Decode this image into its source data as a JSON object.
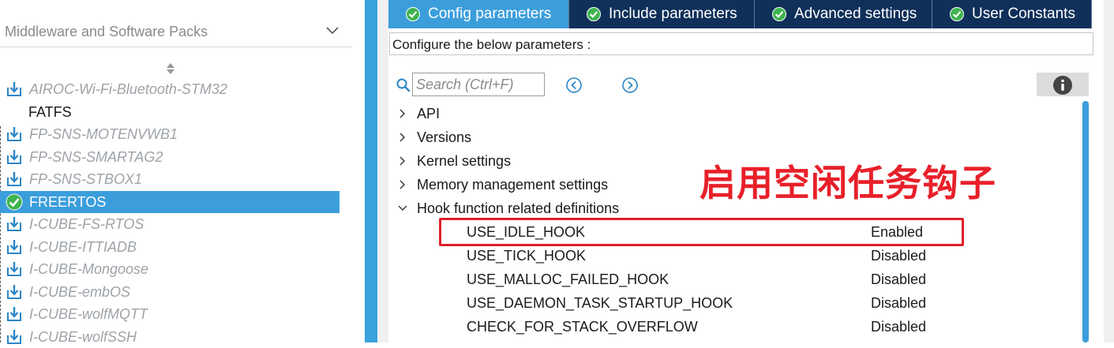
{
  "middleware": {
    "header": "Middleware and Software Packs",
    "packs": [
      {
        "label": "AIROC-Wi-Fi-Bluetooth-STM32",
        "kind": "download"
      },
      {
        "label": "FATFS",
        "kind": "plain"
      },
      {
        "label": "FP-SNS-MOTENVWB1",
        "kind": "download"
      },
      {
        "label": "FP-SNS-SMARTAG2",
        "kind": "download"
      },
      {
        "label": "FP-SNS-STBOX1",
        "kind": "download"
      },
      {
        "label": "FREERTOS",
        "kind": "selected"
      },
      {
        "label": "I-CUBE-FS-RTOS",
        "kind": "download"
      },
      {
        "label": "I-CUBE-ITTIADB",
        "kind": "download"
      },
      {
        "label": "I-CUBE-Mongoose",
        "kind": "download"
      },
      {
        "label": "I-CUBE-embOS",
        "kind": "download"
      },
      {
        "label": "I-CUBE-wolfMQTT",
        "kind": "download"
      },
      {
        "label": "I-CUBE-wolfSSH",
        "kind": "download"
      }
    ]
  },
  "tabs": [
    {
      "label": "Config parameters",
      "active": true
    },
    {
      "label": "Include parameters",
      "active": false
    },
    {
      "label": "Advanced settings",
      "active": false
    },
    {
      "label": "User Constants",
      "active": false
    }
  ],
  "config": {
    "header": "Configure the below parameters :",
    "search_placeholder": "Search (Ctrl+F)",
    "groups": [
      {
        "label": "API",
        "expanded": false
      },
      {
        "label": "Versions",
        "expanded": false
      },
      {
        "label": "Kernel settings",
        "expanded": false
      },
      {
        "label": "Memory management settings",
        "expanded": false
      },
      {
        "label": "Hook function related definitions",
        "expanded": true
      }
    ],
    "params": [
      {
        "name": "USE_IDLE_HOOK",
        "value": "Enabled"
      },
      {
        "name": "USE_TICK_HOOK",
        "value": "Disabled"
      },
      {
        "name": "USE_MALLOC_FAILED_HOOK",
        "value": "Disabled"
      },
      {
        "name": "USE_DAEMON_TASK_STARTUP_HOOK",
        "value": "Disabled"
      },
      {
        "name": "CHECK_FOR_STACK_OVERFLOW",
        "value": "Disabled"
      }
    ]
  },
  "annotation": "启用空闲任务钩子",
  "colors": {
    "accent": "#3b9edb",
    "tabbar": "#10305a",
    "highlight": "#e0202a"
  },
  "icons": {
    "pack_download": "download-box-icon",
    "pack_selected": "green-check-icon",
    "tab_check": "check-circle-icon",
    "search": "search-icon",
    "prev": "arrow-left-circle-icon",
    "next": "arrow-right-circle-icon",
    "info": "info-icon"
  }
}
